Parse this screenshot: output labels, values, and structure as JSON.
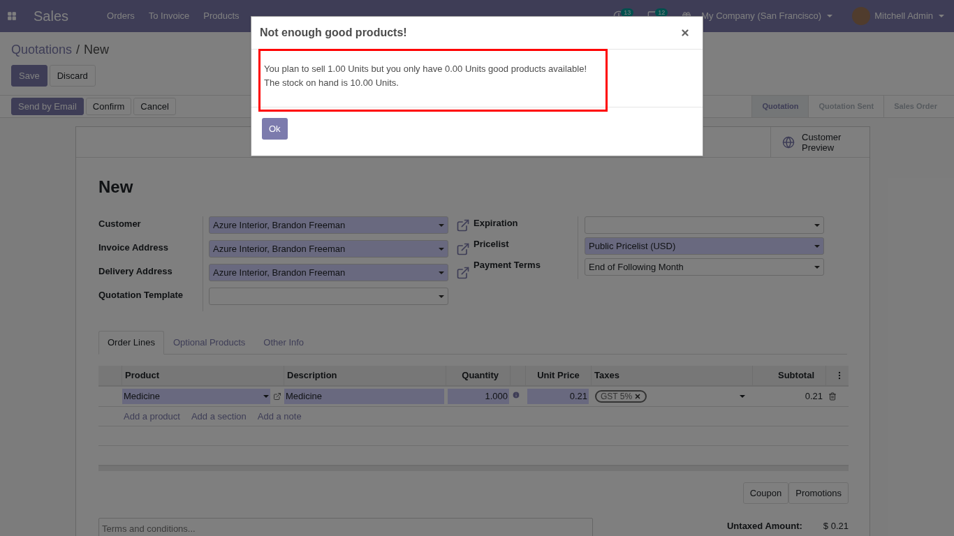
{
  "navbar": {
    "app_name": "Sales",
    "menus": [
      "Orders",
      "To Invoice",
      "Products"
    ],
    "badges": [
      {
        "kind": "activity",
        "count": "13"
      },
      {
        "kind": "chat",
        "count": "12"
      }
    ],
    "company": "My Company (San Francisco)",
    "user": "Mitchell Admin"
  },
  "breadcrumb": [
    "Quotations",
    "New"
  ],
  "breadcrumb_separator": "/",
  "form_buttons": [
    {
      "label": "Save",
      "primary": true
    },
    {
      "label": "Discard",
      "primary": false
    }
  ],
  "actions": [
    {
      "label": "Send by Email",
      "primary": true
    },
    {
      "label": "Confirm",
      "primary": false
    },
    {
      "label": "Cancel",
      "primary": false
    }
  ],
  "stages": [
    {
      "label": "Quotation",
      "selected": true
    },
    {
      "label": "Quotation Sent",
      "selected": false
    },
    {
      "label": "Sales Order",
      "selected": false
    }
  ],
  "smart_button": {
    "label": "Customer Preview"
  },
  "title": "New",
  "left_fields": [
    {
      "label": "Customer",
      "value": "Azure Interior, Brandon Freeman",
      "required": true,
      "external_link": true
    },
    {
      "label": "Invoice Address",
      "value": "Azure Interior, Brandon Freeman",
      "required": true,
      "external_link": true
    },
    {
      "label": "Delivery Address",
      "value": "Azure Interior, Brandon Freeman",
      "required": true,
      "external_link": true
    },
    {
      "label": "Quotation Template",
      "required": false,
      "external_link": false
    }
  ],
  "right_fields": [
    {
      "label": "Expiration",
      "required": false
    },
    {
      "label": "Pricelist",
      "value": "Public Pricelist (USD)",
      "required": true
    },
    {
      "label": "Payment Terms",
      "value": "End of Following Month",
      "required": false
    }
  ],
  "tabs": [
    {
      "label": "Order Lines",
      "selected": true
    },
    {
      "label": "Optional Products",
      "selected": false
    },
    {
      "label": "Other Info",
      "selected": false
    }
  ],
  "table": {
    "columns": [
      "Product",
      "Description",
      "Quantity",
      "Unit Price",
      "Taxes",
      "Subtotal"
    ],
    "rows": [
      {
        "product": "Medicine",
        "description": "Medicine",
        "quantity": "1.000",
        "unit_price": "0.21",
        "taxes": [
          "GST 5%"
        ],
        "subtotal": "0.21"
      }
    ],
    "add_links": [
      "Add a product",
      "Add a section",
      "Add a note"
    ]
  },
  "promo_buttons": [
    "Coupon",
    "Promotions"
  ],
  "terms": {
    "placeholder": "Terms and conditions..."
  },
  "totals": [
    {
      "label": "Untaxed Amount:",
      "value": "$ 0.21"
    }
  ],
  "dialog": {
    "title": "Not enough good products!",
    "lines": [
      "You plan to sell 1.00 Units but you only have 0.00 Units good products available!",
      "The stock on hand is 10.00 Units."
    ],
    "highlighted": true,
    "button": "Ok"
  }
}
